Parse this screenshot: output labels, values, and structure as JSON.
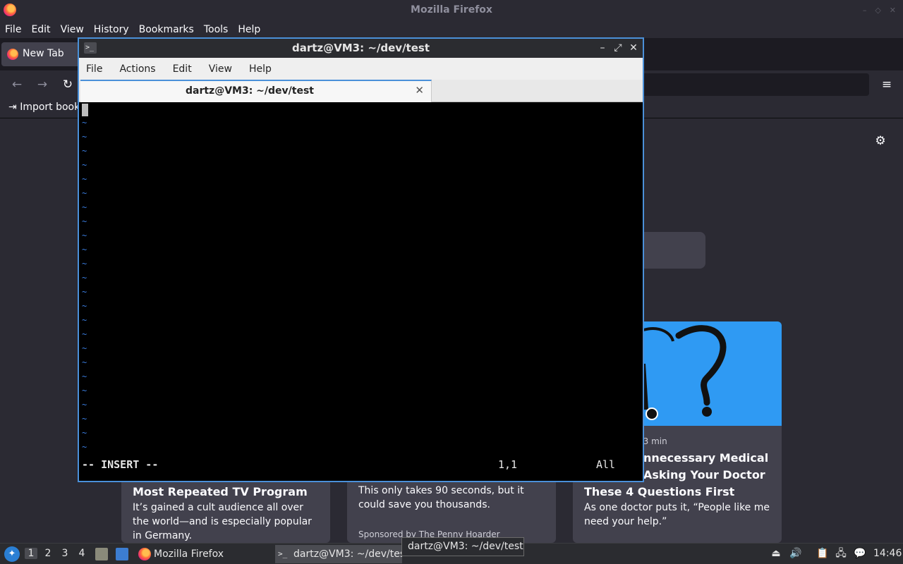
{
  "firefox": {
    "window_title": "Mozilla Firefox",
    "menu": [
      "File",
      "Edit",
      "View",
      "History",
      "Bookmarks",
      "Tools",
      "Help"
    ],
    "tab_label": "New Tab",
    "import_bookmarks": "Import book",
    "cards": [
      {
        "title": "Most Repeated TV Program",
        "text": "It’s gained a cult audience all over the world—and is especially popular in Germany."
      },
      {
        "text": "This only takes 90 seconds, but it could save you thousands.",
        "sponsor": "Sponsored by The Penny Hoarder"
      },
      {
        "meta": "· 3 min",
        "title_lines": [
          "nnecessary Medical",
          "Asking Your Doctor",
          "These 4 Questions First"
        ],
        "text": "As one doctor puts it, “People like me need your help.”"
      }
    ]
  },
  "terminal": {
    "window_title": "dartz@VM3: ~/dev/test",
    "menu": [
      "File",
      "Actions",
      "Edit",
      "View",
      "Help"
    ],
    "tab_label": "dartz@VM3: ~/dev/test",
    "tilde": "~",
    "vim_mode": "-- INSERT --",
    "vim_position": "1,1",
    "vim_scroll": "All"
  },
  "taskbar": {
    "workspaces": [
      "1",
      "2",
      "3",
      "4"
    ],
    "tasks": [
      "Mozilla Firefox",
      "dartz@VM3: ~/dev/tes"
    ],
    "tooltip": "dartz@VM3: ~/dev/test",
    "clock": "14:46"
  }
}
